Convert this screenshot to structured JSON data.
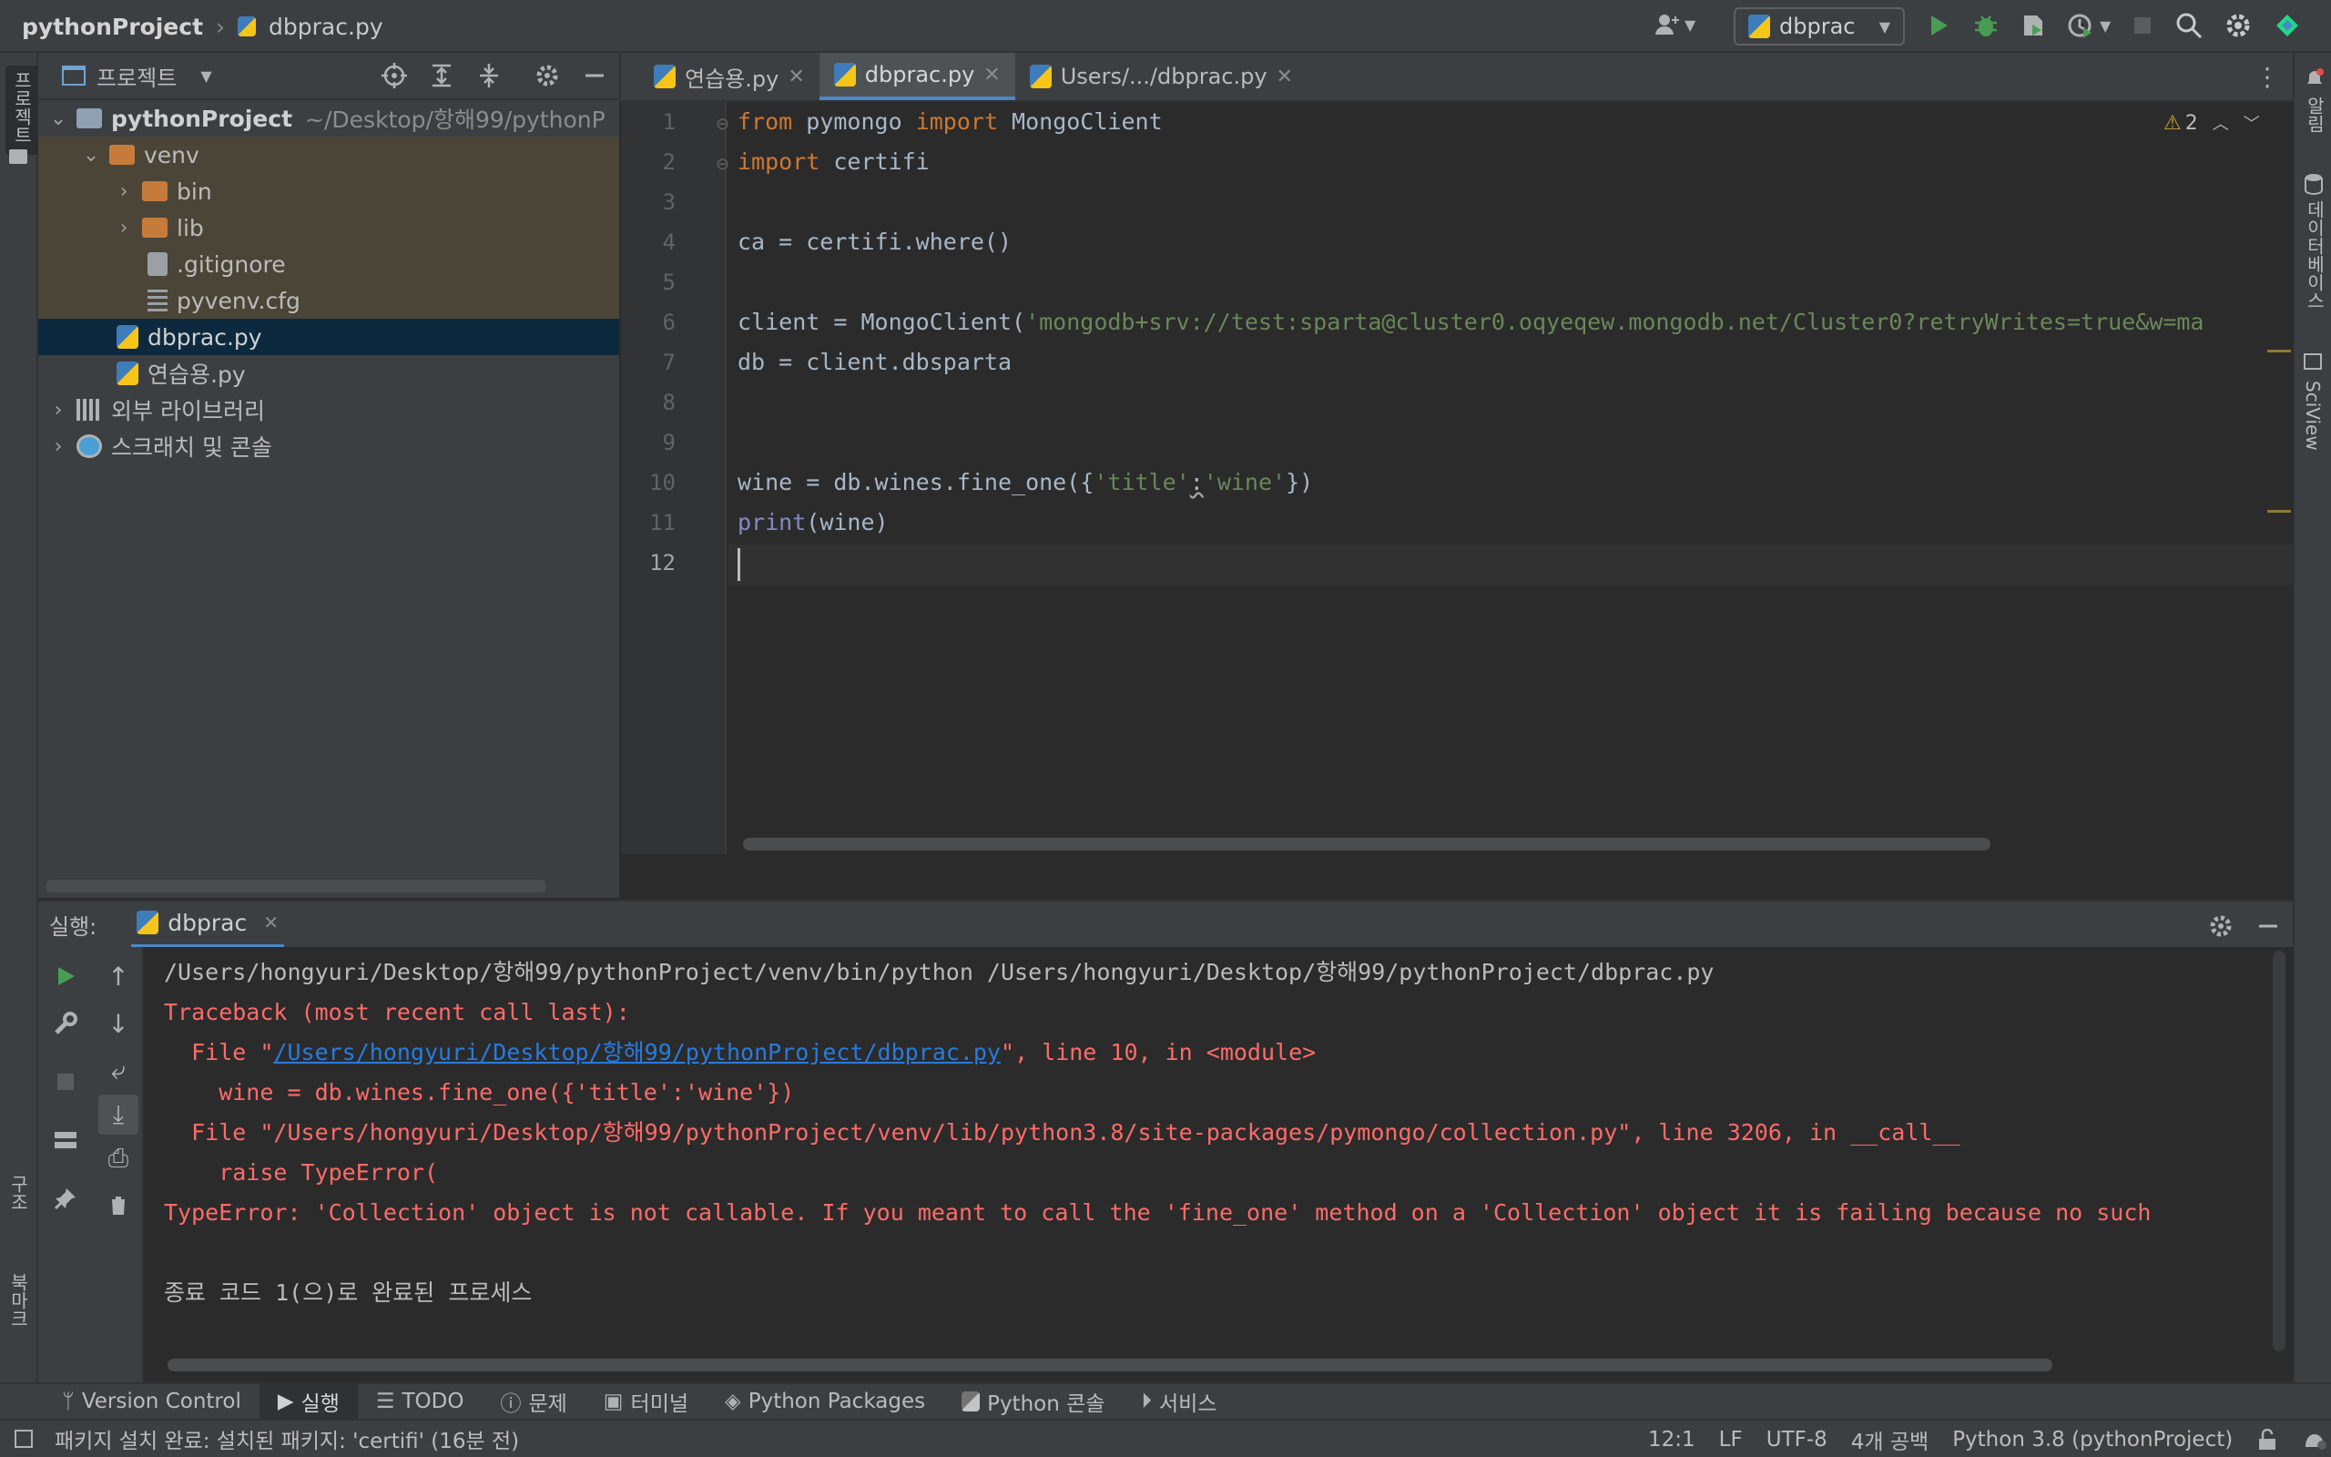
{
  "titlebar": {
    "project": "pythonProject",
    "file": "dbprac.py",
    "run_config": "dbprac"
  },
  "project_panel": {
    "title": "프로젝트",
    "root_name": "pythonProject",
    "root_path": "~/Desktop/항해99/pythonP",
    "items": [
      {
        "label": "venv"
      },
      {
        "label": "bin"
      },
      {
        "label": "lib"
      },
      {
        "label": ".gitignore"
      },
      {
        "label": "pyvenv.cfg"
      },
      {
        "label": "dbprac.py"
      },
      {
        "label": "연습용.py"
      },
      {
        "label": "외부 라이브러리"
      },
      {
        "label": "스크래치 및 콘솔"
      }
    ]
  },
  "left_strip": {
    "project": "프로젝트",
    "structure": "구조",
    "bookmarks": "북마크"
  },
  "right_strip": {
    "notifications": "알림",
    "database": "데이터베이스",
    "sciview": "SciView"
  },
  "editor": {
    "tabs": [
      {
        "label": "연습용.py"
      },
      {
        "label": "dbprac.py"
      },
      {
        "label": "Users/.../dbprac.py"
      }
    ],
    "warnings": "2",
    "line_numbers": [
      "1",
      "2",
      "3",
      "4",
      "5",
      "6",
      "7",
      "8",
      "9",
      "10",
      "11",
      "12"
    ],
    "code": {
      "l1_from": "from",
      "l1_mod": " pymongo ",
      "l1_import": "import",
      "l1_name": " MongoClient",
      "l2_import": "import",
      "l2_name": " certifi",
      "l4": "ca = certifi.where()",
      "l6_pre": "client = MongoClient(",
      "l6_str": "'mongodb+srv://test:sparta@cluster0.oqyeqew.mongodb.net/Cluster0?retryWrites=true&w=ma",
      "l7": "db = client.dbsparta",
      "l10_pre": "wine = db.wines.fine_one({",
      "l10_s1": "'title'",
      "l10_colon": ":",
      "l10_s2": "'wine'",
      "l10_post": "})",
      "l11_fn": "print",
      "l11_rest": "(wine)"
    }
  },
  "run_panel": {
    "label": "실행:",
    "tab": "dbprac",
    "output": {
      "cmd": "/Users/hongyuri/Desktop/항해99/pythonProject/venv/bin/python /Users/hongyuri/Desktop/항해99/pythonProject/dbprac.py",
      "tb": "Traceback (most recent call last):",
      "f1_pre": "  File \"",
      "f1_link": "/Users/hongyuri/Desktop/항해99/pythonProject/dbprac.py",
      "f1_post": "\", line 10, in <module>",
      "f1_code": "    wine = db.wines.fine_one({'title':'wine'})",
      "f2": "  File \"/Users/hongyuri/Desktop/항해99/pythonProject/venv/lib/python3.8/site-packages/pymongo/collection.py\", line 3206, in __call__",
      "f2_code": "    raise TypeError(",
      "error": "TypeError: 'Collection' object is not callable. If you meant to call the 'fine_one' method on a 'Collection' object it is failing because no such",
      "exit": "종료 코드 1(으)로 완료된 프로세스"
    }
  },
  "bottom_bar": {
    "items": [
      {
        "label": "Version Control"
      },
      {
        "label": "실행"
      },
      {
        "label": "TODO"
      },
      {
        "label": "문제"
      },
      {
        "label": "터미널"
      },
      {
        "label": "Python Packages"
      },
      {
        "label": "Python 콘솔"
      },
      {
        "label": "서비스"
      }
    ]
  },
  "status": {
    "message": "패키지 설치 완료: 설치된 패키지: 'certifi' (16분 전)",
    "position": "12:1",
    "line_sep": "LF",
    "encoding": "UTF-8",
    "indent": "4개 공백",
    "interpreter": "Python 3.8 (pythonProject)"
  },
  "colors": {
    "background": "#2b2b2b",
    "panel": "#3c3f41",
    "keyword": "#cc7832",
    "string": "#6a8759",
    "error": "#ff6b68",
    "link": "#287bde",
    "run_green": "#499c54"
  }
}
